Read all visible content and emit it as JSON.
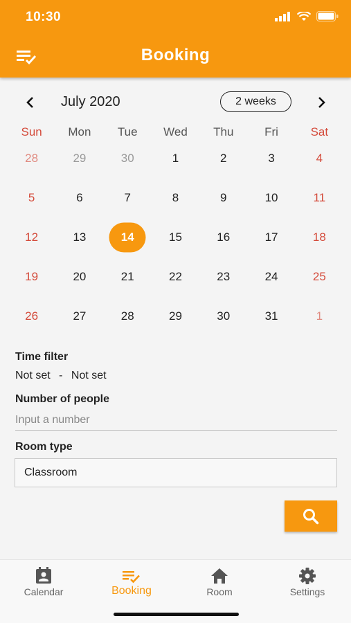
{
  "status_bar": {
    "time": "10:30"
  },
  "app_bar": {
    "title": "Booking",
    "menu_icon": "booking-list-icon"
  },
  "calendar": {
    "month_label": "July 2020",
    "format_label": "2 weeks",
    "prev_icon": "chevron-left-icon",
    "next_icon": "chevron-right-icon",
    "days_of_week": [
      "Sun",
      "Mon",
      "Tue",
      "Wed",
      "Thu",
      "Fri",
      "Sat"
    ],
    "weeks": [
      [
        "28",
        "29",
        "30",
        "1",
        "2",
        "3",
        "4"
      ],
      [
        "5",
        "6",
        "7",
        "8",
        "9",
        "10",
        "11"
      ],
      [
        "12",
        "13",
        "14",
        "15",
        "16",
        "17",
        "18"
      ],
      [
        "19",
        "20",
        "21",
        "22",
        "23",
        "24",
        "25"
      ],
      [
        "26",
        "27",
        "28",
        "29",
        "30",
        "31",
        "1"
      ]
    ],
    "selected_day": "14",
    "accent_color": "#f7980f",
    "weekend_color": "#d44a3a"
  },
  "filters": {
    "time_filter_label": "Time filter",
    "time_from": "Not set",
    "time_separator": "-",
    "time_to": "Not set",
    "people_label": "Number of people",
    "people_placeholder": "Input a number",
    "people_value": "",
    "room_type_label": "Room type",
    "room_type_value": "Classroom",
    "search_icon": "search-icon"
  },
  "bottom_nav": {
    "tabs": [
      {
        "label": "Calendar",
        "icon": "calendar-person-icon"
      },
      {
        "label": "Booking",
        "icon": "booking-list-icon",
        "active": true
      },
      {
        "label": "Room",
        "icon": "home-icon"
      },
      {
        "label": "Settings",
        "icon": "gear-icon"
      }
    ]
  }
}
